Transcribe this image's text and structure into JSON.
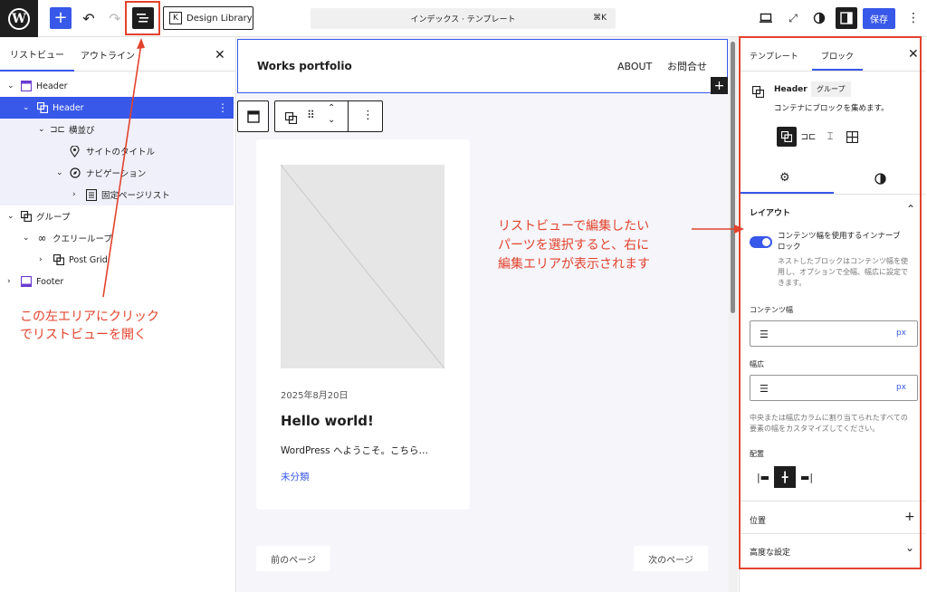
{
  "topbar": {
    "design_library": "Design Library",
    "command_title": "インデックス · テンプレート",
    "command_shortcut": "⌘K",
    "save_label": "保存"
  },
  "left_panel": {
    "tabs": [
      "リストビュー",
      "アウトライン"
    ],
    "tree": [
      {
        "label": "Header",
        "icon": "template-part-icon"
      },
      {
        "label": "Header",
        "icon": "group-icon"
      },
      {
        "label": "横並び",
        "icon": "row-icon"
      },
      {
        "label": "サイトのタイトル",
        "icon": "map-pin-icon"
      },
      {
        "label": "ナビゲーション",
        "icon": "compass-icon"
      },
      {
        "label": "固定ページリスト",
        "icon": "pages-icon"
      },
      {
        "label": "グループ",
        "icon": "group-icon"
      },
      {
        "label": "クエリーループ",
        "icon": "loop-icon"
      },
      {
        "label": "Post Grid",
        "icon": "group-icon"
      },
      {
        "label": "Footer",
        "icon": "template-part-icon"
      }
    ]
  },
  "annotations": {
    "left": [
      "この左エリアにクリック",
      "でリストビューを開く"
    ],
    "right": [
      "リストビューで編集したい",
      "パーツを選択すると、右に",
      "編集エリアが表示されます"
    ]
  },
  "canvas": {
    "site_title": "Works portfolio",
    "nav": [
      "ABOUT",
      "お問合せ"
    ],
    "post": {
      "date": "2025年8月20日",
      "title": "Hello world!",
      "excerpt": "WordPress へようこそ。こちら…",
      "category": "未分類"
    },
    "prev": "前のページ",
    "next": "次のページ"
  },
  "right_panel": {
    "tabs": [
      "テンプレート",
      "ブロック"
    ],
    "block_name": "Header",
    "block_badge": "グループ",
    "block_desc": "コンテナにブロックを集めます。",
    "layout_title": "レイアウト",
    "toggle_label": [
      "コンテンツ幅を使用するインナーブ",
      "ロック"
    ],
    "toggle_help": [
      "ネストしたブロックはコンテンツ幅を使",
      "用し、オプションで全幅、幅広に設定で",
      "きます。"
    ],
    "content_width_label": "コンテンツ幅",
    "wide_label": "幅広",
    "unit": "px",
    "wide_help": [
      "中央または幅広カラムに割り当てられたすべての",
      "要素の幅をカスタマイズしてください。"
    ],
    "justify_label": "配置",
    "position_label": "位置",
    "advanced_label": "高度な設定"
  },
  "colors": {
    "accent": "#3858e9",
    "annotation": "#e2432d",
    "dark": "#1e1e1e"
  }
}
